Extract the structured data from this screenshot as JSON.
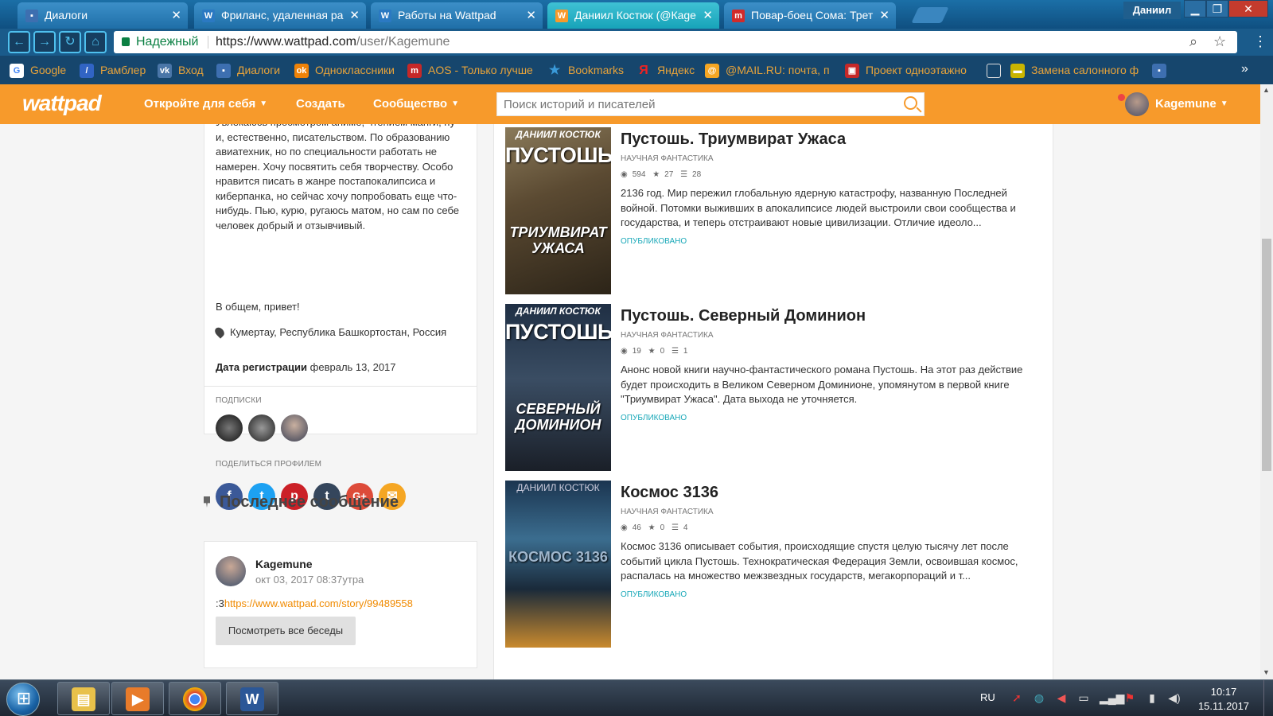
{
  "browser": {
    "tabs": [
      {
        "title": "Диалоги",
        "icon": "chat-icon",
        "color": "#3d6fb0"
      },
      {
        "title": "Фриланс, удаленная ра",
        "icon": "w-icon",
        "color": "#2b79c2"
      },
      {
        "title": "Работы на Wattpad",
        "icon": "w-icon",
        "color": "#2b79c2"
      },
      {
        "title": "Даниил Костюк (@Каge",
        "icon": "wattpad-icon",
        "color": "#f79a2b"
      },
      {
        "title": "Повар-боец Сома: Трет",
        "icon": "comic-icon",
        "color": "#d12b2b"
      }
    ],
    "window_user": "Даниил",
    "secure_label": "Надежный",
    "url_prefix": "https://www.wattpad.com",
    "url_rest": "/user/Kagemune",
    "bookmarks": [
      {
        "label": "Google",
        "icon": "google-icon",
        "color": "#4285f4"
      },
      {
        "label": "Рамблер",
        "icon": "rambler-icon",
        "color": "#3164c4"
      },
      {
        "label": "Вход",
        "icon": "vk-icon",
        "color": "#4a76a8"
      },
      {
        "label": "Диалоги",
        "icon": "chat-icon",
        "color": "#3d6fb0"
      },
      {
        "label": "Одноклассники",
        "icon": "ok-icon",
        "color": "#ee8208"
      },
      {
        "label": "AOS - Только лучше",
        "icon": "aos-icon",
        "color": "#c62828"
      },
      {
        "label": "Bookmarks",
        "icon": "star-icon",
        "color": "#3a9ad9"
      },
      {
        "label": "Яндекс",
        "icon": "yandex-icon",
        "color": "#e22"
      },
      {
        "label": "@MAIL.RU: почта, п",
        "icon": "mail-icon",
        "color": "#f5a623"
      },
      {
        "label": "Проект одноэтажно",
        "icon": "project-icon",
        "color": "#c62828"
      },
      {
        "label": "",
        "icon": "page-icon",
        "color": "#dddddd"
      },
      {
        "label": "Замена салонного ф",
        "icon": "car-icon",
        "color": "#c8b400"
      },
      {
        "label": "",
        "icon": "chat-icon",
        "color": "#3d6fb0"
      }
    ]
  },
  "wattpad": {
    "logo": "wattpad",
    "nav": {
      "discover": "Откройте для себя",
      "create": "Создать",
      "community": "Сообщество"
    },
    "search_placeholder": "Поиск историй и писателей",
    "username": "Kagemune",
    "accent": "#f79a2b"
  },
  "about": {
    "text": "Увлекаюсь просмотром аниме, чтением манги, ну и, естественно, писательством. По образованию авиатехник, но по специальности работать не намерен. Хочу посвятить себя творчеству. Особо нравится писать в жанре постапокалипсиса и киберпанка, но сейчас хочу попробовать еще что-нибудь. Пью, курю, ругаюсь матом, но сам по себе человек добрый и отзывчивый.",
    "hello": "В общем, привет!",
    "location": "Кумертау, Республика Башкортостан, Россия",
    "reg_label": "Дата регистрации",
    "reg_date": "февраль 13, 2017",
    "following_label": "Подписки",
    "share_label": "Поделиться профилем"
  },
  "share": [
    {
      "icon": "facebook-icon",
      "glyph": "f",
      "color": "#3b5998"
    },
    {
      "icon": "twitter-icon",
      "glyph": "t",
      "color": "#1da1f2"
    },
    {
      "icon": "pinterest-icon",
      "glyph": "p",
      "color": "#cb2027"
    },
    {
      "icon": "tumblr-icon",
      "glyph": "t",
      "color": "#35465c"
    },
    {
      "icon": "googleplus-icon",
      "glyph": "G+",
      "color": "#dd4b39"
    },
    {
      "icon": "email-icon",
      "glyph": "✉",
      "color": "#f5a623"
    }
  ],
  "pinned": {
    "title": "Последнее сообщение",
    "user": "Kagemune",
    "time": "окт 03, 2017 08:37утра",
    "prefix": ":3",
    "link": "https://www.wattpad.com/story/99489558",
    "button": "Посмотреть все беседы"
  },
  "stories": [
    {
      "title": "Пустошь. Триумвират Ужаса",
      "genre": "Научная фантастика",
      "reads": "594",
      "votes": "27",
      "parts": "28",
      "description": "2136 год. Мир пережил глобальную ядерную катастрофу, названную Последней войной. Потомки выживших в апокалипсисе людей выстроили свои сообщества и государства, и теперь отстраивают новые цивилизации. Отличие идеоло...",
      "status": "Опубликовано",
      "cover_author": "ДАНИИЛ КОСТЮК",
      "cover_big": "ПУСТОШЬ",
      "cover_sub": "ТРИУМВИРАТ УЖАСА"
    },
    {
      "title": "Пустошь. Северный Доминион",
      "genre": "Научная фантастика",
      "reads": "19",
      "votes": "0",
      "parts": "1",
      "description": "Анонс новой книги научно-фантастического романа Пустошь. На этот раз действие будет происходить в Великом Северном Доминионе, упомянутом в первой книге \"Триумвират Ужаса\". Дата выхода не уточняется.",
      "status": "Опубликовано",
      "cover_author": "ДАНИИЛ КОСТЮК",
      "cover_big": "ПУСТОШЬ",
      "cover_sub": "СЕВЕРНЫЙ ДОМИНИОН"
    },
    {
      "title": "Космос 3136",
      "genre": "Научная фантастика",
      "reads": "46",
      "votes": "0",
      "parts": "4",
      "description": "Космос 3136 описывает события, происходящие спустя целую тысячу лет после событий цикла Пустошь. Технократическая Федерация Земли, освоившая космос, распалась на множество межзвездных государств, мегакорпораций и т...",
      "status": "Опубликовано",
      "cover_author": "ДАНИИЛ КОСТЮК",
      "cover_big": "",
      "cover_sub": "КОСМОС 3136"
    }
  ],
  "taskbar": {
    "lang": "RU",
    "time": "10:17",
    "date": "15.11.2017",
    "apps": [
      {
        "icon": "file-explorer-icon",
        "color": "#e8c14a"
      },
      {
        "icon": "media-player-icon",
        "color": "#e87b2a"
      },
      {
        "icon": "chrome-icon",
        "color": "#2e9d4a"
      },
      {
        "icon": "word-icon",
        "color": "#2b5797"
      }
    ]
  }
}
